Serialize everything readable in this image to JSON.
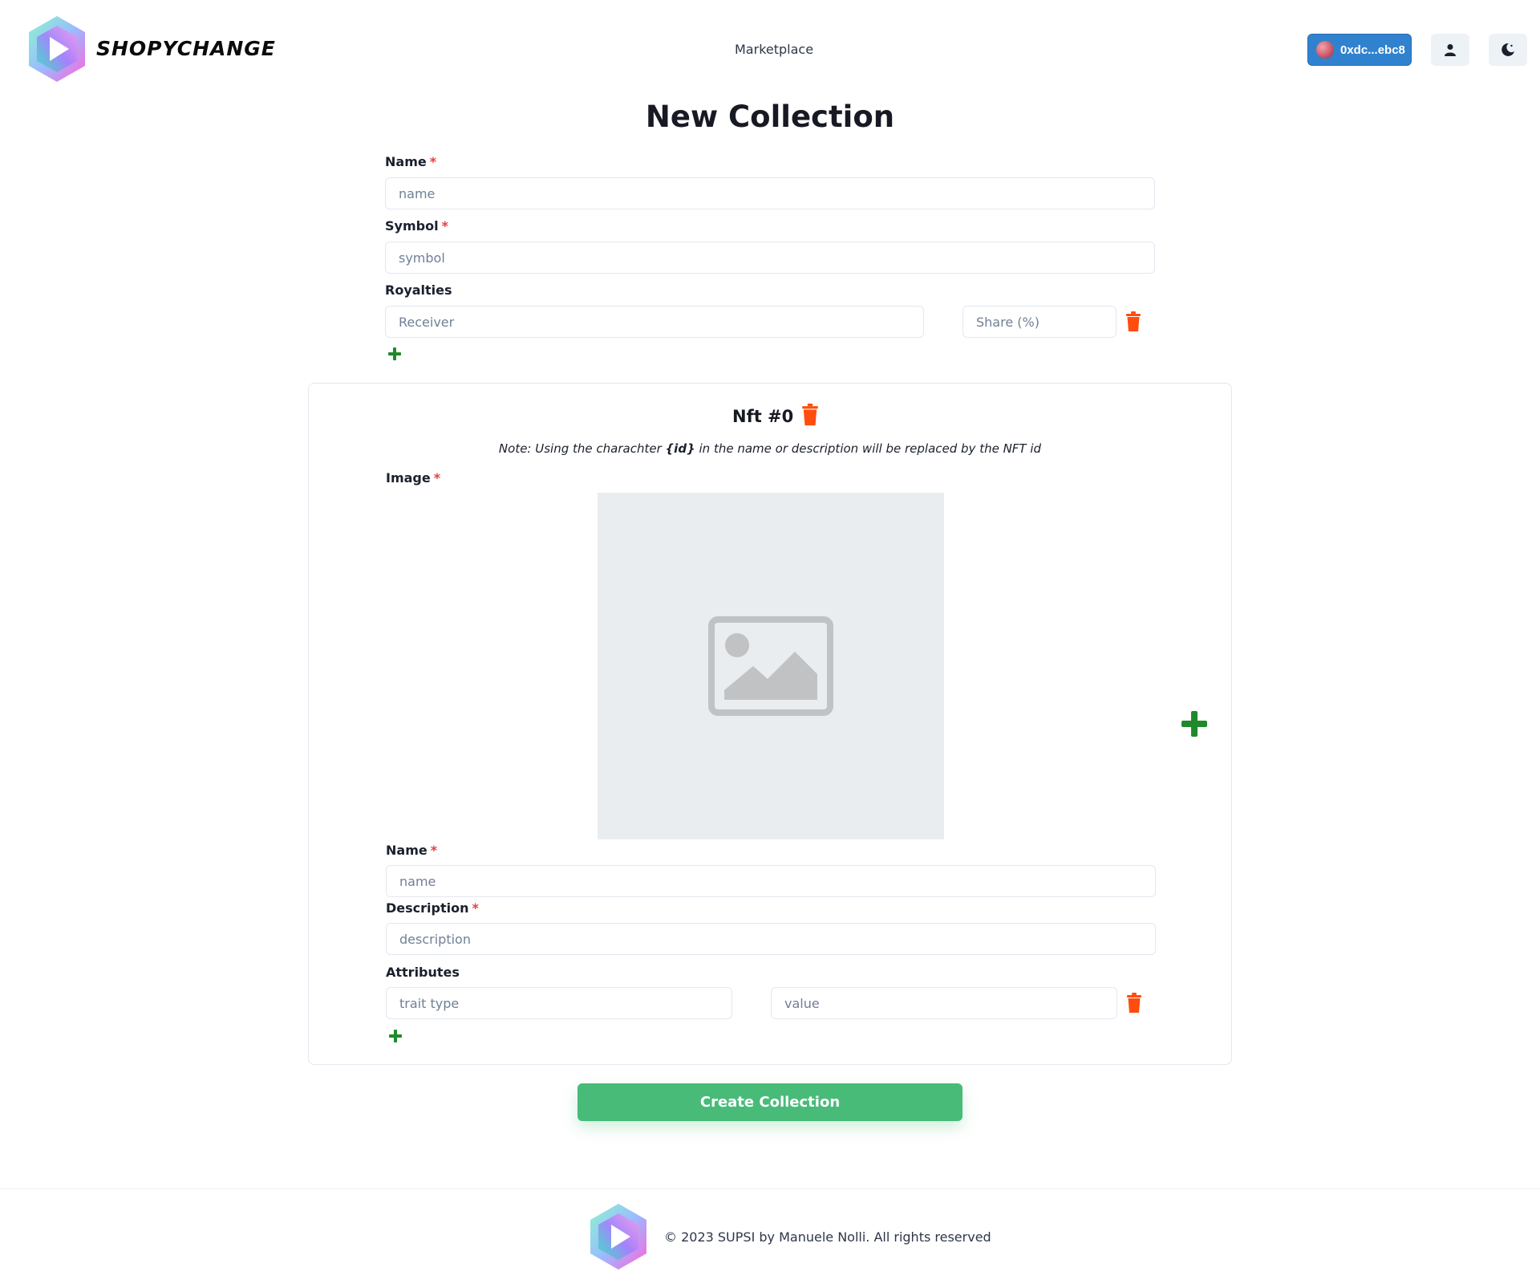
{
  "header": {
    "brand": "SHOPYCHANGE",
    "nav_link": "Marketplace",
    "wallet_label": "0xdc...ebc8",
    "user_icon": "user-icon",
    "theme_icon": "moon-icon"
  },
  "page": {
    "title": "New Collection"
  },
  "collection_form": {
    "name_label": "Name",
    "name_placeholder": "name",
    "symbol_label": "Symbol",
    "symbol_placeholder": "symbol",
    "royalties_label": "Royalties",
    "receiver_placeholder": "Receiver",
    "share_placeholder": "Share (%)",
    "required_mark": "*"
  },
  "nft": {
    "title": "Nft #0",
    "note_prefix": "Note: Using the charachter ",
    "note_token": "{id}",
    "note_suffix": " in the name or description will be replaced by the NFT id",
    "image_label": "Image",
    "name_label": "Name",
    "name_placeholder": "name",
    "description_label": "Description",
    "description_placeholder": "description",
    "attributes_label": "Attributes",
    "trait_placeholder": "trait type",
    "value_placeholder": "value"
  },
  "actions": {
    "create_label": "Create Collection"
  },
  "footer": {
    "copyright": "© 2023 SUPSI by Manuele Nolli. All rights reserved"
  },
  "colors": {
    "primary": "#3182ce",
    "success": "#48bb78",
    "danger_icon": "#ff4d0d",
    "add_icon": "#1e8a2a",
    "required": "#e53e3e"
  }
}
